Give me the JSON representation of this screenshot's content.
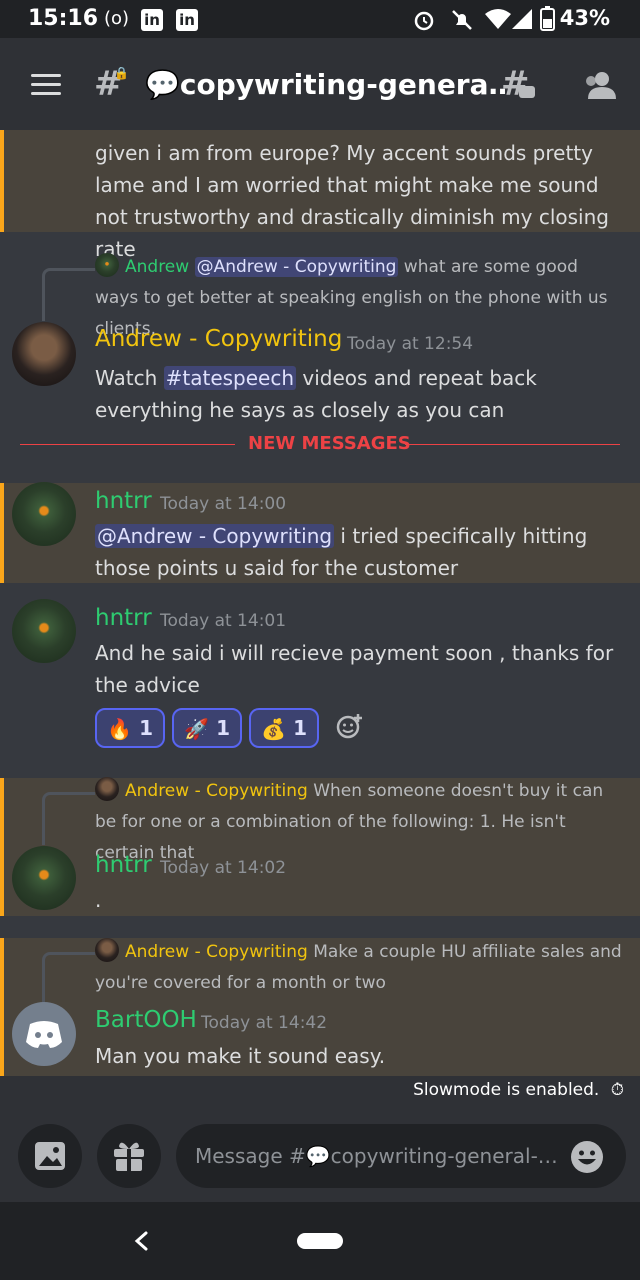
{
  "status_bar": {
    "time": "15:16",
    "battery": "43%",
    "icons": [
      "radio-icon",
      "linkedin-icon",
      "linkedin-icon",
      "alarm-icon",
      "mute-icon",
      "wifi-icon",
      "signal-icon",
      "battery-icon"
    ]
  },
  "header": {
    "channel_name": "💬copywriting-genera…",
    "icons": [
      "hamburger-icon",
      "locked-hash-icon",
      "threads-icon",
      "members-icon"
    ]
  },
  "messages": [
    {
      "id": "m0",
      "author": "",
      "text": "given i am from europe? My accent sounds pretty lame and I am worried that might make me sound not trustworthy and drastically diminish my closing rate",
      "highlighted": true
    },
    {
      "id": "m1",
      "author": "Andrew - Copywriting",
      "author_color": "#f1c40f",
      "timestamp": "Today at 12:54",
      "reply": {
        "author": "Andrew",
        "mention": "@Andrew - Copywriting",
        "text": " what are some good ways to get better at speaking english on the phone with us clients,"
      },
      "text_before": "Watch ",
      "channel_mention": "#tatespeech",
      "text_after": " videos and repeat back everything he says as closely as you can"
    },
    {
      "id": "m2",
      "author": "hntrr",
      "author_color": "#2ecc71",
      "timestamp": "Today at 14:00",
      "highlighted": true,
      "mention": "@Andrew - Copywriting",
      "text": " i tried specifically hitting those points u said for the customer"
    },
    {
      "id": "m3",
      "author": "hntrr",
      "author_color": "#2ecc71",
      "timestamp": "Today at 14:01",
      "text": "And he said i will recieve payment soon , thanks for the advice",
      "reactions": [
        {
          "emoji": "🔥",
          "count": "1"
        },
        {
          "emoji": "🚀",
          "count": "1"
        },
        {
          "emoji": "💰",
          "count": "1"
        }
      ]
    },
    {
      "id": "m4",
      "author": "hntrr",
      "author_color": "#2ecc71",
      "timestamp": "Today at 14:02",
      "highlighted": true,
      "reply": {
        "author": "Andrew - Copywriting",
        "text": "When someone doesn't buy it can be for one or a combination of the following:  1. He isn't certain that"
      },
      "text": "."
    },
    {
      "id": "m5",
      "author": "BartOOH",
      "author_color": "#2ecc71",
      "timestamp": "Today at 14:42",
      "highlighted": true,
      "reply": {
        "author": "Andrew - Copywriting",
        "text": "Make a couple HU affiliate sales and you're covered for a month or two"
      },
      "text": "Man you make it sound easy."
    }
  ],
  "divider": {
    "label": "NEW MESSAGES"
  },
  "slowmode": {
    "label": "Slowmode is enabled."
  },
  "composer": {
    "placeholder": "Message #💬copywriting-general-…"
  },
  "colors": {
    "background": "#36393f",
    "highlight": "#49443c",
    "mention_bg": "#414675",
    "accent": "#5865f2",
    "new_messages": "#ed4245"
  }
}
